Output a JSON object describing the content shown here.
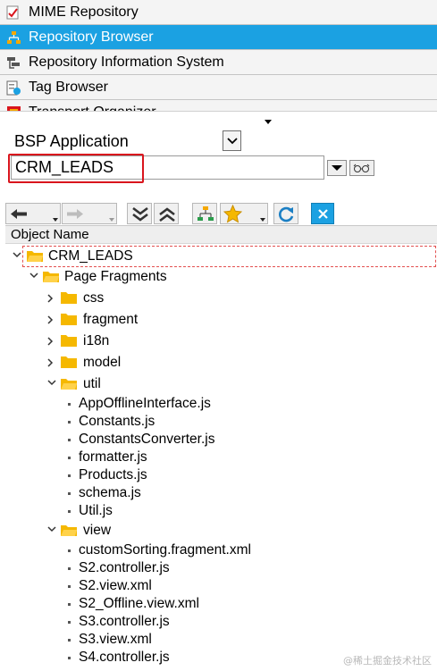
{
  "nav": {
    "items": [
      {
        "label": "MIME Repository",
        "icon": "mime-repository-icon",
        "active": false
      },
      {
        "label": "Repository Browser",
        "icon": "repository-browser-icon",
        "active": true
      },
      {
        "label": "Repository Information System",
        "icon": "repository-info-system-icon",
        "active": false
      },
      {
        "label": "Tag Browser",
        "icon": "tag-browser-icon",
        "active": false
      },
      {
        "label": "Transport Organizer",
        "icon": "transport-organizer-icon",
        "active": false
      }
    ]
  },
  "selector": {
    "object_type": "BSP Application",
    "object_name": "CRM_LEADS"
  },
  "tree": {
    "column_header": "Object Name",
    "root": "CRM_LEADS",
    "page_fragments": "Page Fragments",
    "folders_collapsed": [
      "css",
      "fragment",
      "i18n",
      "model"
    ],
    "util_folder": "util",
    "util_files": [
      "AppOfflineInterface.js",
      "Constants.js",
      "ConstantsConverter.js",
      "formatter.js",
      "Products.js",
      "schema.js",
      "Util.js"
    ],
    "view_folder": "view",
    "view_files": [
      "customSorting.fragment.xml",
      "S2.controller.js",
      "S2.view.xml",
      "S2_Offline.view.xml",
      "S3.controller.js",
      "S3.view.xml",
      "S4.controller.js"
    ]
  },
  "colors": {
    "active_tab": "#1ba1e2",
    "highlight_box": "#d9151d",
    "folder": "#f5b800"
  },
  "watermark": "@稀土掘金技术社区"
}
